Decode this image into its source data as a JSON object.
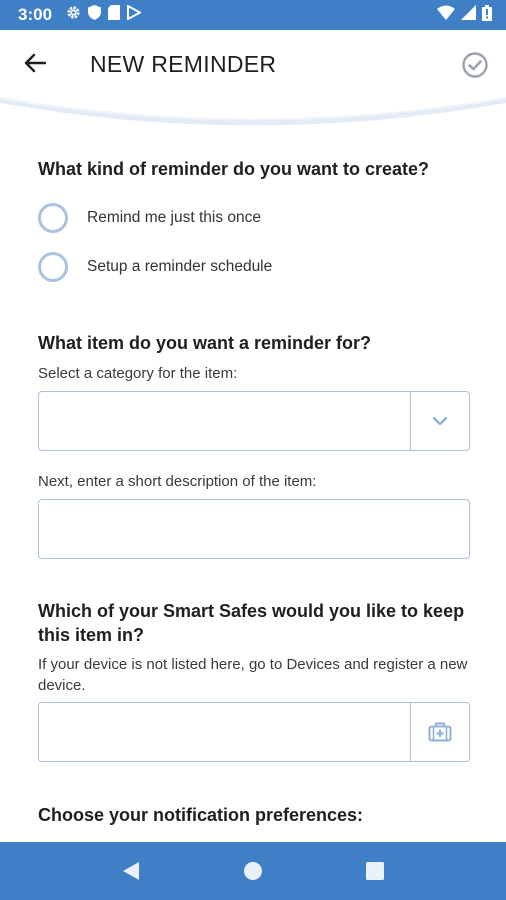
{
  "status_bar": {
    "time": "3:00",
    "left_icons": [
      "gear-icon",
      "shield-icon",
      "sd-card-icon",
      "play-store-icon"
    ],
    "right_icons": [
      "wifi-icon",
      "signal-icon",
      "battery-icon"
    ],
    "background": "#3f7fc6"
  },
  "header": {
    "title": "NEW REMINDER",
    "back_icon": "arrow-left-icon",
    "save_icon": "check-circle-icon"
  },
  "sections": {
    "kind": {
      "question": "What kind of reminder do you want to create?",
      "options": [
        {
          "label": "Remind me just this once",
          "selected": false
        },
        {
          "label": "Setup a reminder schedule",
          "selected": false
        }
      ]
    },
    "item": {
      "question": "What item do you want a reminder for?",
      "category_helper": "Select a category for the item:",
      "category_value": "",
      "category_icon": "chevron-down-icon",
      "description_helper": "Next, enter a short description of the item:",
      "description_value": ""
    },
    "safe": {
      "question": "Which of your Smart Safes would you like to keep this item in?",
      "helper": "If your device is not listed here, go to Devices and register a new device.",
      "device_value": "",
      "device_icon": "safe-icon"
    },
    "notifications": {
      "question": "Choose your notification preferences:"
    }
  },
  "nav_bar": {
    "buttons": [
      "back-triangle-icon",
      "home-circle-icon",
      "recents-square-icon"
    ],
    "background": "#3f7fc6"
  },
  "colors": {
    "accent": "#3f7fc6",
    "field_border": "#a9c2e0",
    "check_icon": "#9aa3ad"
  }
}
